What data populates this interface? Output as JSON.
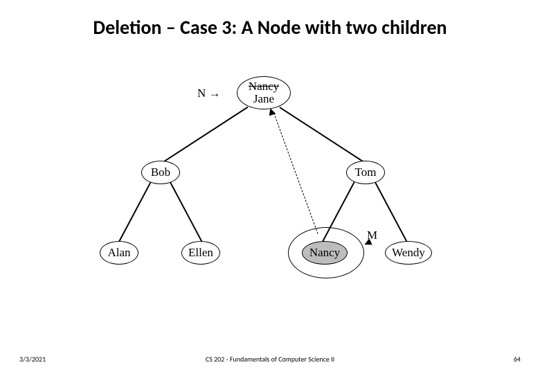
{
  "title": "Deletion – Case 3: A Node with two children",
  "footer": {
    "date": "3/3/2021",
    "center": "CS 202 - Fundamentals of Computer Science II",
    "page": "64"
  },
  "labels": {
    "N": "N",
    "M": "M"
  },
  "nodes": {
    "root_old": "Nancy",
    "root_new": "Jane",
    "left": "Bob",
    "right": "Tom",
    "ll": "Alan",
    "lr": "Ellen",
    "rl": "Nancy",
    "rr": "Wendy"
  }
}
